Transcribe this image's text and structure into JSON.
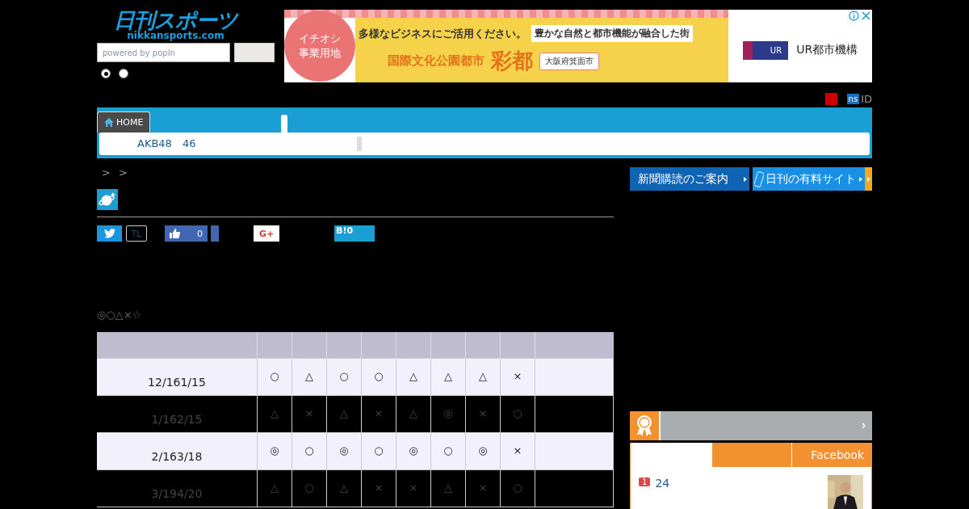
{
  "logo": {
    "title": "日刊スポーツ",
    "domain": "nikkansports.com"
  },
  "search": {
    "placeholder": "powered by popIn"
  },
  "radios": [
    {
      "selected": true
    },
    {
      "selected": false
    }
  ],
  "ad": {
    "badge": [
      "イチオシ",
      "事業用地"
    ],
    "headline": "多様なビジネスにご活用ください。",
    "tagline": "豊かな自然と都市機能が融合した街",
    "city_prefix": "国際文化公園都市",
    "city": "彩都",
    "location": "大阪府箕面市",
    "brand_mark": "UR",
    "brand": "UR都市機構"
  },
  "account": {
    "badge": "ns",
    "label": "ID"
  },
  "nav": {
    "home": "HOME",
    "subnav": "AKB48　46"
  },
  "breadcrumb": [
    ">",
    ">"
  ],
  "promo_buttons": [
    {
      "label": "新聞購読のご案内",
      "kind": "paper"
    },
    {
      "label": "日刊の有料サイト",
      "kind": "mobile"
    }
  ],
  "share": {
    "tl": "TL",
    "like_count": "0",
    "gplus": "G+",
    "hatena": "B!0"
  },
  "legend": "◎○△×☆",
  "table": {
    "rows": [
      {
        "date": "12/161/15",
        "marks": [
          "○",
          "△",
          "○",
          "○",
          "△",
          "△",
          "△",
          "×"
        ]
      },
      {
        "date": "1/162/15",
        "marks": [
          "△",
          "×",
          "△",
          "×",
          "△",
          "◎",
          "×",
          "○"
        ]
      },
      {
        "date": "2/163/18",
        "marks": [
          "◎",
          "○",
          "◎",
          "○",
          "◎",
          "○",
          "◎",
          "×"
        ]
      },
      {
        "date": "3/194/20",
        "marks": [
          "△",
          "○",
          "△",
          "×",
          "×",
          "△",
          "×",
          "○"
        ]
      }
    ]
  },
  "ranking": {
    "tabs": [
      {
        "selected": true
      },
      {
        "selected": false
      },
      {
        "label": "Facebook",
        "selected": false
      }
    ],
    "items": [
      {
        "rank": "1",
        "title": "24",
        "kind": "picture"
      }
    ]
  }
}
